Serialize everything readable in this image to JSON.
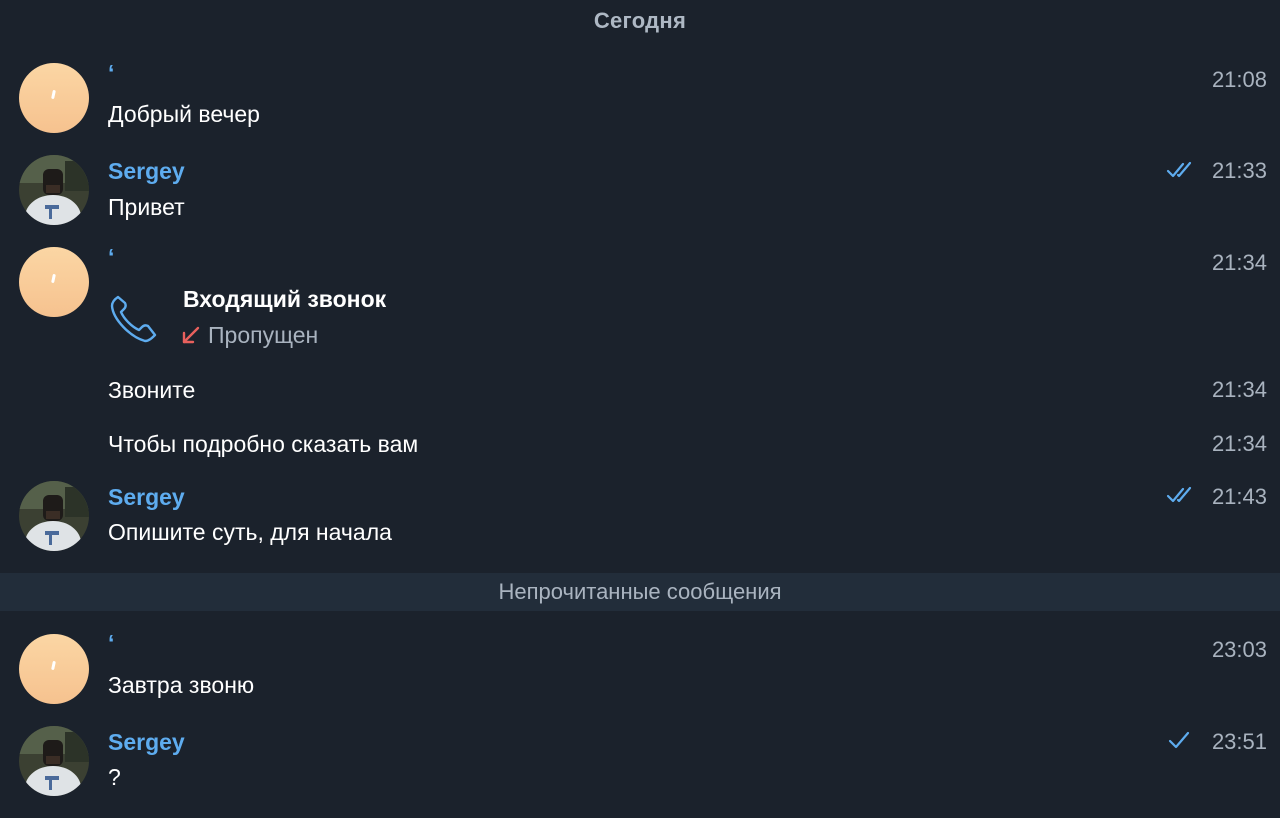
{
  "date_separator": "Сегодня",
  "unread_separator": "Непрочитанные сообщения",
  "colors": {
    "background": "#1b222c",
    "sender_name": "#5eacef",
    "timestamp": "#a9b3bf",
    "unread_bar": "#222d3a",
    "missed_call_arrow": "#e8605d",
    "peach_avatar": "#f9cd99"
  },
  "messages": [
    {
      "sender": "ʻ",
      "text": "Добрый вечер",
      "time": "21:08",
      "avatar": "peach-avatar"
    },
    {
      "sender": "Sergey",
      "text": "Привет",
      "time": "21:33",
      "avatar": "photo-avatar",
      "status": "double-check-icon"
    },
    {
      "sender": "ʻ",
      "time": "21:34",
      "avatar": "peach-avatar",
      "call": {
        "title": "Входящий звонок",
        "status": "Пропущен",
        "icon": "phone-icon",
        "status_icon": "missed-call-arrow-icon"
      }
    },
    {
      "text": "Звоните",
      "time": "21:34"
    },
    {
      "text": "Чтобы подробно сказать вам",
      "time": "21:34"
    },
    {
      "sender": "Sergey",
      "text": "Опишите суть, для начала",
      "time": "21:43",
      "avatar": "photo-avatar",
      "status": "double-check-icon"
    },
    {
      "sender": "ʻ",
      "text": "Завтра звоню",
      "time": "23:03",
      "avatar": "peach-avatar"
    },
    {
      "sender": "Sergey",
      "text": "?",
      "time": "23:51",
      "avatar": "photo-avatar",
      "status": "single-check-icon"
    }
  ]
}
